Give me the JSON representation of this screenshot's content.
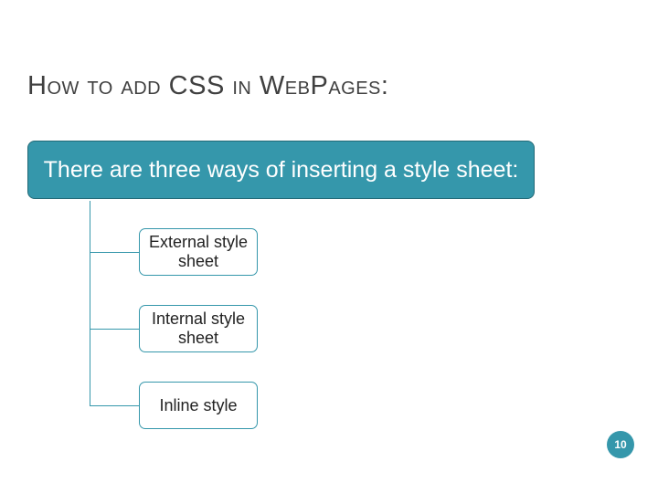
{
  "title": "How to add CSS in WebPages:",
  "banner": "There are three ways of inserting a style sheet:",
  "nodes": {
    "item1": "External style sheet",
    "item2": "Internal style sheet",
    "item3": "Inline style"
  },
  "page_number": "10"
}
